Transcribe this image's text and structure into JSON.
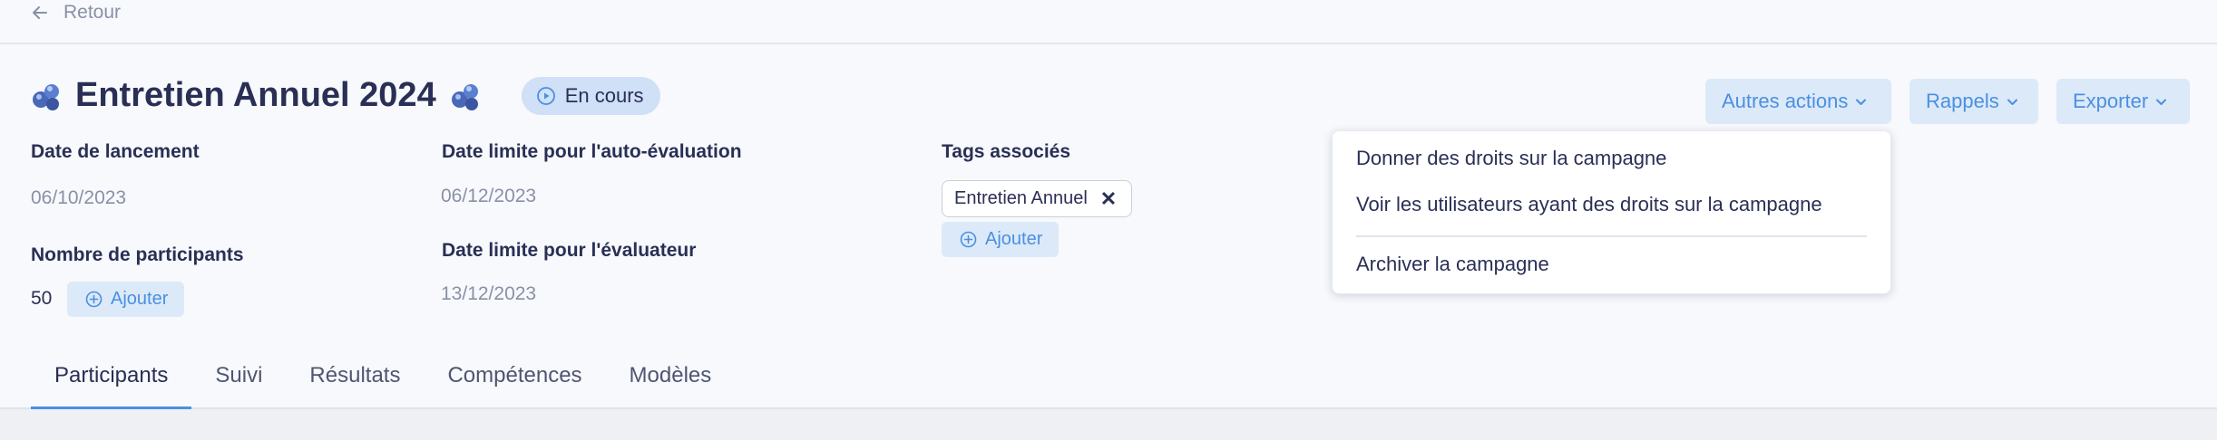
{
  "nav": {
    "back_label": "Retour"
  },
  "header": {
    "title": "Entretien Annuel 2024",
    "status": "En cours"
  },
  "actions": {
    "other_actions": "Autres actions",
    "reminders": "Rappels",
    "export": "Exporter"
  },
  "fields": {
    "launch_date_label": "Date de lancement",
    "launch_date_value": "06/10/2023",
    "self_eval_label": "Date limite pour l'auto-évaluation",
    "self_eval_value": "06/12/2023",
    "tags_label": "Tags associés",
    "participants_label": "Nombre de participants",
    "participants_value": "50",
    "evaluator_label": "Date limite pour l'évaluateur",
    "evaluator_value": "13/12/2023"
  },
  "tags": [
    {
      "label": "Entretien Annuel"
    }
  ],
  "add_label": "Ajouter",
  "menu": {
    "items": [
      "Donner des droits sur la campagne",
      "Voir les utilisateurs ayant des droits sur la campagne",
      "Archiver la campagne"
    ]
  },
  "tabs": [
    {
      "label": "Participants",
      "active": true
    },
    {
      "label": "Suivi"
    },
    {
      "label": "Résultats"
    },
    {
      "label": "Compétences"
    },
    {
      "label": "Modèles"
    }
  ],
  "colors": {
    "accent": "#4a90e2",
    "status_bg": "#cfe0f7",
    "button_bg": "#dce9f8",
    "text": "#2a2f55"
  },
  "icons": {
    "back": "arrow-left-icon",
    "status": "play-circle-icon",
    "dropdown": "chevron-down-icon",
    "add": "plus-circle-icon",
    "remove": "close-icon",
    "emoji": "molecule-icon"
  }
}
